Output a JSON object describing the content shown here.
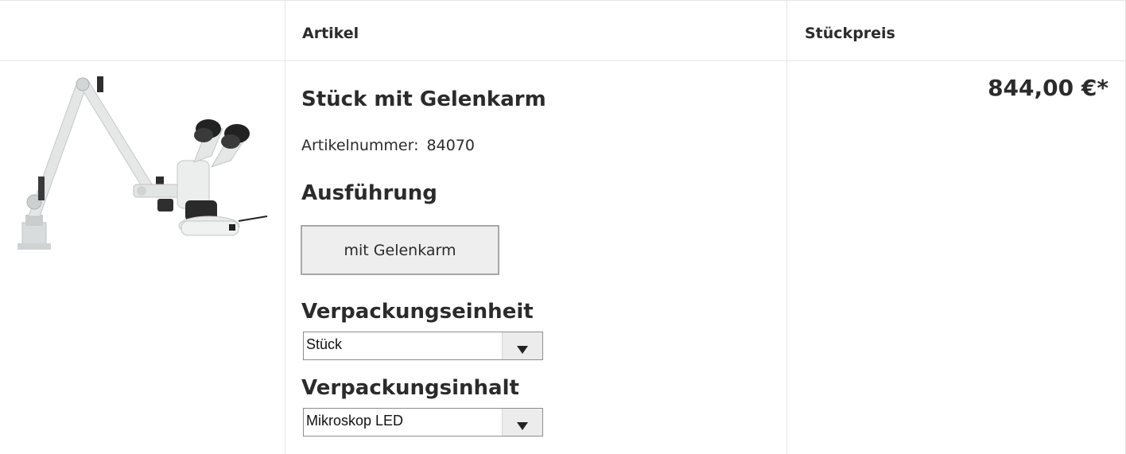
{
  "table": {
    "header": {
      "image_col": "",
      "article_col": "Artikel",
      "price_col": "Stückpreis"
    }
  },
  "product": {
    "title": "Stück mit Gelenkarm",
    "sku_label": "Artikelnummer:",
    "sku_value": "84070",
    "image_icon": "microscope-with-articulated-arm",
    "variant_heading": "Ausführung",
    "variant_button": "mit Gelenkarm",
    "packaging_unit_heading": "Verpackungseinheit",
    "packaging_unit_selected": "Stück",
    "packaging_content_heading": "Verpackungsinhalt",
    "packaging_content_selected": "Mikroskop LED",
    "price": "844,00 €*"
  },
  "colors": {
    "border": "#e6e6e6",
    "text": "#2b2b2b",
    "button_bg": "#eeeeee",
    "button_border": "#a8a8a8"
  }
}
